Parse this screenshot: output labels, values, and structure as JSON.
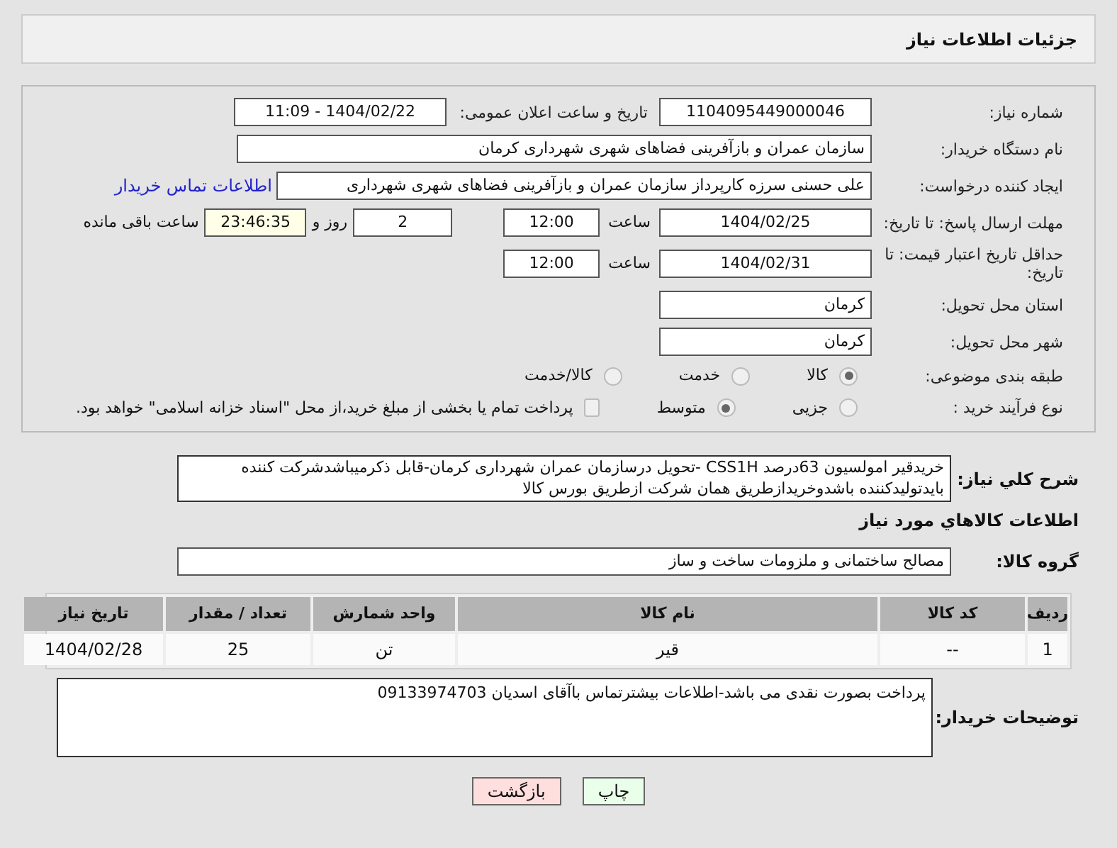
{
  "header": {
    "title": "جزئیات اطلاعات نیاز"
  },
  "fields": {
    "need_number": {
      "label": "شماره نیاز:",
      "value": "1104095449000046"
    },
    "announce": {
      "label": "تاریخ و ساعت اعلان عمومی:",
      "value": "1404/02/22 - 11:09"
    },
    "buyer_org": {
      "label": "نام دستگاه خریدار:",
      "value": "سازمان عمران و بازآفرینی فضاهای شهری شهرداری کرمان"
    },
    "requester": {
      "label": "ایجاد کننده درخواست:",
      "value": "علی حسنی سرزه کارپرداز سازمان عمران و بازآفرینی فضاهای شهری شهرداری",
      "link": "اطلاعات تماس خریدار"
    },
    "deadline": {
      "label": "مهلت ارسال پاسخ: تا تاریخ:",
      "date": "1404/02/25",
      "time_label": "ساعت",
      "time": "12:00",
      "days": "2",
      "days_label": "روز و",
      "remaining": "23:46:35",
      "remaining_label": "ساعت باقی مانده"
    },
    "validity": {
      "label": "حداقل تاریخ اعتبار قیمت: تا تاریخ:",
      "date": "1404/02/31",
      "time_label": "ساعت",
      "time": "12:00"
    },
    "province": {
      "label": "استان محل تحویل:",
      "value": "کرمان"
    },
    "city": {
      "label": "شهر محل تحویل:",
      "value": "کرمان"
    },
    "category": {
      "label": "طبقه بندی موضوعی:",
      "options": [
        {
          "label": "کالا",
          "selected": true
        },
        {
          "label": "خدمت",
          "selected": false
        },
        {
          "label": "کالا/خدمت",
          "selected": false
        }
      ]
    },
    "purchase_type": {
      "label": "نوع فرآیند خرید :",
      "options": [
        {
          "label": "جزیی",
          "selected": false
        },
        {
          "label": "متوسط",
          "selected": true
        }
      ],
      "payment": {
        "label": "پرداخت تمام یا بخشی از مبلغ خرید،از محل \"اسناد خزانه اسلامی\" خواهد بود.",
        "checked": false
      }
    }
  },
  "description": {
    "label": "شرح کلي نياز:",
    "value": "خریدقیر امولسیون 63درصد CSS1H -تحویل درسازمان عمران شهرداری کرمان-قابل ذکرمیباشدشرکت کننده بایدتولیدکننده باشدوخریدازطریق همان شرکت ازطریق بورس کالا"
  },
  "goods_heading": "اطلاعات کالاهاي مورد نياز",
  "goods_group": {
    "label": "گروه کالا:",
    "value": "مصالح ساختمانی و ملزومات ساخت و ساز"
  },
  "table": {
    "columns": [
      "ردیف",
      "کد کالا",
      "نام کالا",
      "واحد شمارش",
      "تعداد / مقدار",
      "تاریخ نیاز"
    ],
    "rows": [
      [
        "1",
        "--",
        "قیر",
        "تن",
        "25",
        "1404/02/28"
      ]
    ]
  },
  "buyer_notes": {
    "label": "توضیحات خریدار:",
    "value": "پرداخت بصورت نقدی می باشد-اطلاعات بیشترتماس باآقای اسدیان 09133974703"
  },
  "buttons": [
    {
      "label": "چاپ",
      "kind": "print"
    },
    {
      "label": "بازگشت",
      "kind": "back"
    }
  ]
}
